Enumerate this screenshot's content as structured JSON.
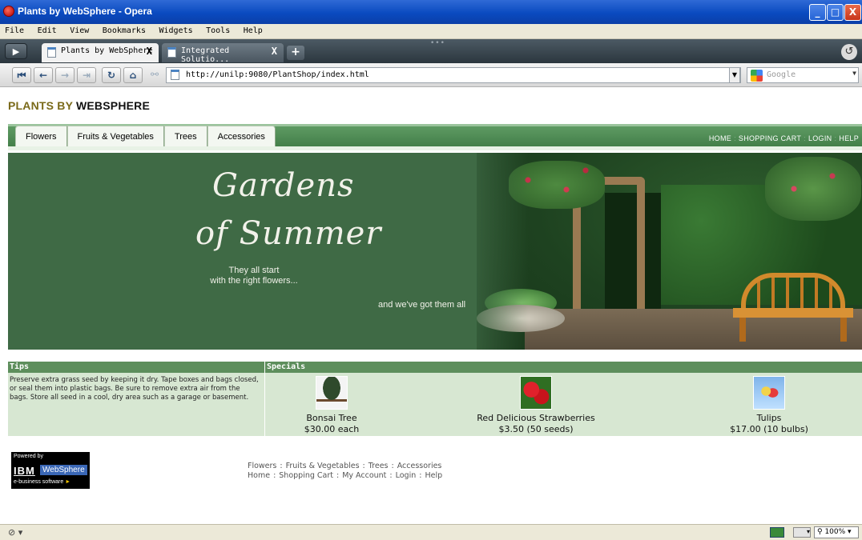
{
  "window": {
    "title": "Plants by WebSphere - Opera",
    "controls": {
      "minimize": "_",
      "maximize": "□",
      "close": "X"
    }
  },
  "menu": [
    "File",
    "Edit",
    "View",
    "Bookmarks",
    "Widgets",
    "Tools",
    "Help"
  ],
  "browser_tabs": [
    {
      "label": "Plants by WebSphere",
      "active": true,
      "close": "X"
    },
    {
      "label": "Integrated Solutio...",
      "active": false,
      "close": "X"
    }
  ],
  "new_tab_label": "+",
  "address": {
    "url": "http://unilp:9080/PlantShop/index.html"
  },
  "search": {
    "placeholder": "Google"
  },
  "nav_icons": [
    "rewind-icon",
    "back-icon",
    "forward-icon",
    "fast-forward-icon",
    "reload-icon",
    "home-icon",
    "key-icon"
  ],
  "site": {
    "logo_part1": "PLANTS BY",
    "logo_part2": "WEBSPHERE",
    "tabs": [
      "Flowers",
      "Fruits & Vegetables",
      "Trees",
      "Accessories"
    ],
    "top_links": [
      "HOME",
      "SHOPPING CART",
      "LOGIN",
      "HELP"
    ],
    "top_link_separator": ":",
    "colors": {
      "nav_green": "#4a8650",
      "banner_green": "#3f6a45",
      "promo_bg": "#d7e7d2",
      "header_green": "#5d8e5c",
      "logo_olive": "#7a6a1a"
    }
  },
  "banner": {
    "headline_line1": "Gardens",
    "headline_line2": "of Summer",
    "tagline_line1": "They all start",
    "tagline_line2": "with the right flowers...",
    "tagline_end": "and we've got them all"
  },
  "tips": {
    "heading": "Tips",
    "text": "Preserve extra grass seed by keeping it dry. Tape boxes and bags closed, or seal them into plastic bags. Be sure to remove extra air from the bags. Store all seed in a cool, dry area such as a garage or basement."
  },
  "specials": {
    "heading": "Specials",
    "items": [
      {
        "name": "Bonsai Tree",
        "price": "$30.00 each"
      },
      {
        "name": "Red Delicious Strawberries",
        "price": "$3.50 (50 seeds)"
      },
      {
        "name": "Tulips",
        "price": "$17.00 (10 bulbs)"
      }
    ]
  },
  "powered_by": {
    "label": "Powered by",
    "brand": "IBM",
    "product": "WebSphere",
    "tagline": "e-business software"
  },
  "footer": {
    "row1": [
      "Flowers",
      "Fruits & Vegetables",
      "Trees",
      "Accessories"
    ],
    "row2": [
      "Home",
      "Shopping Cart",
      "My Account",
      "Login",
      "Help"
    ],
    "separator": ":"
  },
  "status": {
    "zoom": "100%"
  }
}
